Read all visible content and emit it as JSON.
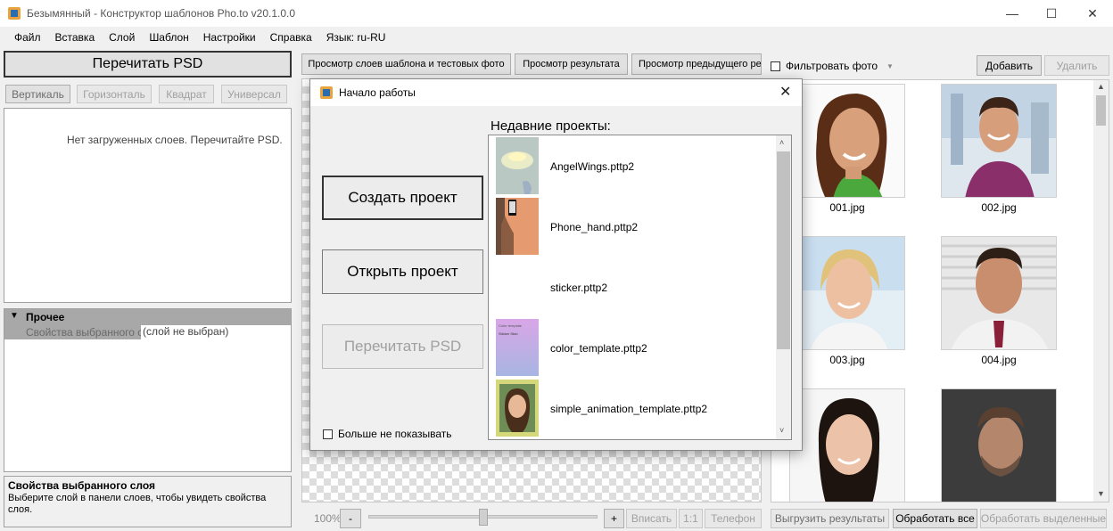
{
  "window": {
    "title": "Безымянный - Конструктор шаблонов Pho.to v20.1.0.0",
    "controls": {
      "minimize": "—",
      "maximize": "☐",
      "close": "✕"
    }
  },
  "menu": [
    "Файл",
    "Вставка",
    "Слой",
    "Шаблон",
    "Настройки",
    "Справка",
    "Язык: ru-RU"
  ],
  "left": {
    "reread_psd": "Перечитать PSD",
    "orient_buttons": [
      "Вертикаль",
      "Горизонталь",
      "Квадрат",
      "Универсал"
    ],
    "no_layers": "Нет загруженных слоев. Перечитайте PSD.",
    "props_group": "Прочее",
    "props_row_label": "Свойства выбранного сл",
    "props_row_value": "(слой не выбран)",
    "help_title": "Свойства выбранного слоя",
    "help_text": "Выберите слой в панели слоев, чтобы увидеть свойства слоя."
  },
  "center": {
    "tabs": [
      "Просмотр слоев шаблона и тестовых фото",
      "Просмотр результата",
      "Просмотр предыдущего ре"
    ],
    "zoom": "100%",
    "zoom_minus": "-",
    "zoom_plus": "+",
    "fit": "Вписать",
    "one_to_one": "1:1",
    "phone": "Телефон",
    "zoom_level": 0.5
  },
  "right": {
    "filter_label": "Фильтровать фото",
    "add": "Добавить",
    "remove": "Удалить",
    "photos": [
      "001.jpg",
      "002.jpg",
      "003.jpg",
      "004.jpg"
    ],
    "export": "Выгрузить результаты",
    "process_all": "Обработать все",
    "process_selected": "Обработать выделенные"
  },
  "dialog": {
    "title": "Начало работы",
    "create": "Создать проект",
    "open": "Открыть проект",
    "reread": "Перечитать PSD",
    "recent_label": "Недавние проекты:",
    "recent": [
      "AngelWings.pttp2",
      "Phone_hand.pttp2",
      "sticker.pttp2",
      "color_template.pttp2",
      "simple_animation_template.pttp2"
    ],
    "dont_show": "Больше не показывать",
    "color_template_thumb_title": "Color template",
    "color_template_thumb_sub": "Sticker Stub"
  },
  "colors": {
    "accent": "#e8a33c",
    "window_bg": "#f0f0f0",
    "group_header": "#a8a8a8"
  }
}
